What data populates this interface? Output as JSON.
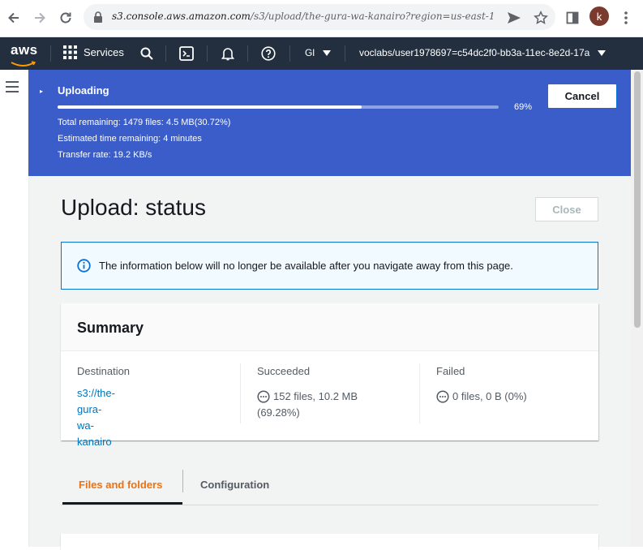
{
  "browser": {
    "url_domain": "s3.console.aws.amazon.com",
    "url_path": "/s3/upload/the-gura-wa-kanairo?region=us-east-1",
    "profile_initial": "k"
  },
  "aws_nav": {
    "logo_text": "aws",
    "services_label": "Services",
    "region_label": "Gl",
    "account_label": "voclabs/user1978697=c54dc2f0-bb3a-11ec-8e2d-17a"
  },
  "upload_banner": {
    "title": "Uploading",
    "progress_percent": 69,
    "progress_label": "69%",
    "total_remaining": "Total remaining: 1479 files: 4.5 MB(30.72%)",
    "estimated_time": "Estimated time remaining: 4 minutes",
    "transfer_rate": "Transfer rate: 19.2 KB/s",
    "cancel_label": "Cancel",
    "color": "#3a5dc9"
  },
  "page": {
    "title": "Upload: status",
    "close_label": "Close"
  },
  "info_alert": {
    "text": "The information below will no longer be available after you navigate away from this page."
  },
  "summary": {
    "title": "Summary",
    "destination_label": "Destination",
    "destination_value": "s3://the-gura-wa-kanairo",
    "succeeded_label": "Succeeded",
    "succeeded_value_line1": "152 files, 10.2 MB",
    "succeeded_value_line2": "(69.28%)",
    "failed_label": "Failed",
    "failed_value": "0 files, 0 B (0%)"
  },
  "tabs": [
    {
      "label": "Files and folders",
      "active": true
    },
    {
      "label": "Configuration",
      "active": false
    }
  ],
  "colors": {
    "aws_nav_bg": "#232f3e",
    "link": "#0073bb",
    "active_tab": "#ec7211",
    "info_border": "#0972d3"
  }
}
